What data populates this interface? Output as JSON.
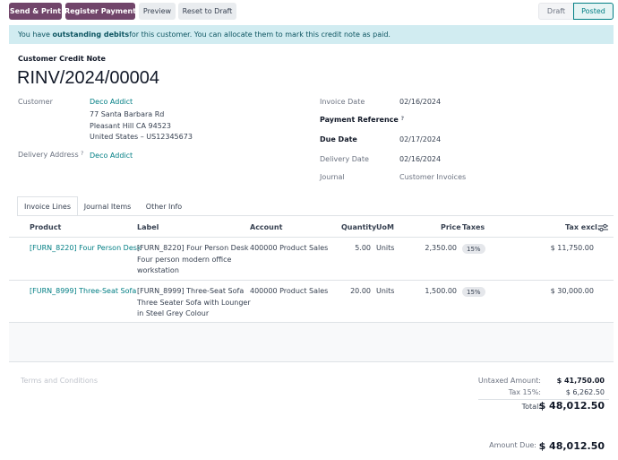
{
  "toolbar": {
    "send_print": "Send & Print",
    "register_payment": "Register Payment",
    "preview": "Preview",
    "reset_to_draft": "Reset to Draft"
  },
  "statusbar": {
    "draft": "Draft",
    "posted": "Posted",
    "active": "Posted"
  },
  "alert": {
    "prefix": "You have ",
    "bold": "outstanding debits",
    "suffix": " for this customer. You can allocate them to mark this credit note as paid."
  },
  "document": {
    "type": "Customer Credit Note",
    "number": "RINV/2024/00004"
  },
  "fields": {
    "customer_label": "Customer",
    "customer_name": "Deco Addict",
    "address_line1": "77 Santa Barbara Rd",
    "address_line2": "Pleasant Hill CA 94523",
    "address_line3": "United States – US12345673",
    "delivery_address_label": "Delivery Address",
    "delivery_address_value": "Deco Addict",
    "invoice_date_label": "Invoice Date",
    "invoice_date_value": "02/16/2024",
    "payment_reference_label": "Payment Reference",
    "due_date_label": "Due Date",
    "due_date_value": "02/17/2024",
    "delivery_date_label": "Delivery Date",
    "delivery_date_value": "02/16/2024",
    "journal_label": "Journal",
    "journal_value": "Customer Invoices",
    "help_mark": "?"
  },
  "tabs": [
    {
      "label": "Invoice Lines",
      "active": true
    },
    {
      "label": "Journal Items",
      "active": false
    },
    {
      "label": "Other Info",
      "active": false
    }
  ],
  "table": {
    "headers": {
      "product": "Product",
      "label": "Label",
      "account": "Account",
      "quantity": "Quantity",
      "uom": "UoM",
      "price": "Price",
      "taxes": "Taxes",
      "tax_excl": "Tax excl."
    },
    "rows": [
      {
        "product": "[FURN_8220] Four Person Desk",
        "label_lines": [
          "[FURN_8220] Four Person Desk",
          "Four person modern office",
          "workstation"
        ],
        "account": "400000 Product Sales",
        "quantity": "5.00",
        "uom": "Units",
        "price": "2,350.00",
        "tax": "15%",
        "subtotal": "$ 11,750.00"
      },
      {
        "product": "[FURN_8999] Three-Seat Sofa",
        "label_lines": [
          "[FURN_8999] Three-Seat Sofa",
          "Three Seater Sofa with Lounger",
          "in Steel Grey Colour"
        ],
        "account": "400000 Product Sales",
        "quantity": "20.00",
        "uom": "Units",
        "price": "1,500.00",
        "tax": "15%",
        "subtotal": "$ 30,000.00"
      }
    ]
  },
  "footer": {
    "terms_placeholder": "Terms and Conditions",
    "untaxed_label": "Untaxed Amount:",
    "untaxed_value": "$ 41,750.00",
    "tax_label": "Tax 15%:",
    "tax_value": "$ 6,262.50",
    "total_label": "Total:",
    "total_value": "$ 48,012.50",
    "amount_due_label": "Amount Due:",
    "amount_due_value": "$ 48,012.50"
  },
  "colors": {
    "primary": "#71456a",
    "link": "#017e84",
    "alert_bg": "#d1ecf1"
  }
}
